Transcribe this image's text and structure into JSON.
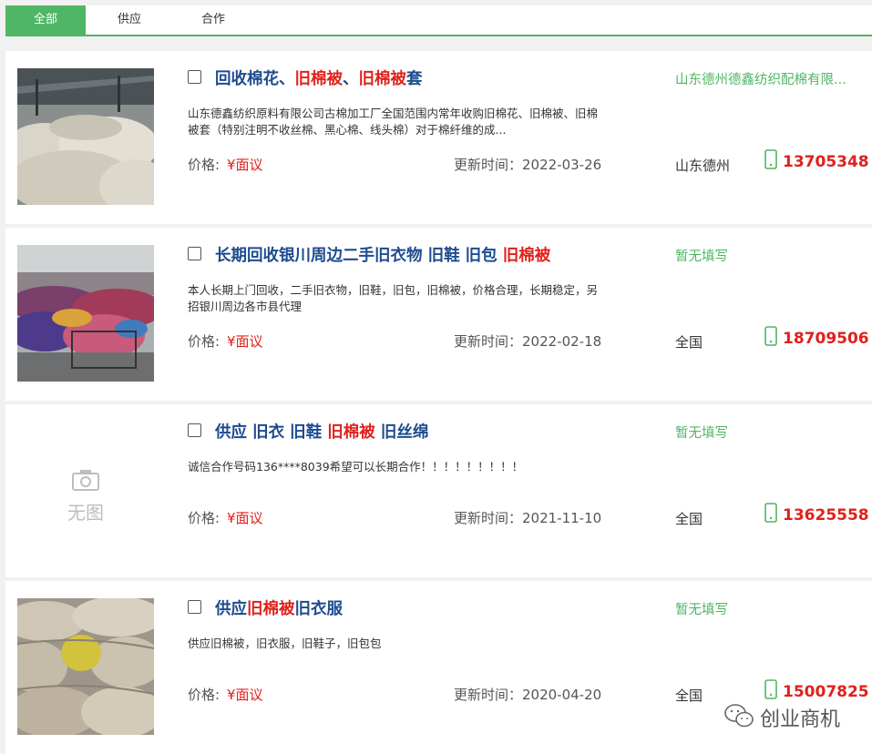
{
  "tabs": [
    {
      "label": "全部",
      "active": true
    },
    {
      "label": "供应",
      "active": false
    },
    {
      "label": "合作",
      "active": false
    }
  ],
  "listings": [
    {
      "title_parts": [
        {
          "text": "回收棉花、",
          "hl": false
        },
        {
          "text": "旧棉被",
          "hl": true
        },
        {
          "text": "、",
          "hl": false
        },
        {
          "text": "旧棉被",
          "hl": true
        },
        {
          "text": "套",
          "hl": false
        }
      ],
      "desc": "山东德鑫纺织原料有限公司古棉加工厂全国范围内常年收购旧棉花、旧棉被、旧棉被套（特别注明不收丝棉、黑心棉、线头棉）对于棉纤维的成...",
      "price_label": "价格:",
      "price": "¥面议",
      "update": "更新时间：2022-03-26",
      "company": "山东德州德鑫纺织配棉有限...",
      "location": "山东德州",
      "phone": "13705348",
      "image": "photo-warehouse-cotton"
    },
    {
      "title_parts": [
        {
          "text": "长期回收银川周边二手旧衣物 旧鞋 旧包 ",
          "hl": false
        },
        {
          "text": "旧棉被",
          "hl": true
        }
      ],
      "desc": "本人长期上门回收，二手旧衣物，旧鞋，旧包，旧棉被，价格合理，长期稳定，另招银川周边各市县代理",
      "price_label": "价格:",
      "price": "¥面议",
      "update": "更新时间：2022-02-18",
      "company": "暂无填写",
      "location": "全国",
      "phone": "18709506",
      "image": "photo-clothes-pile"
    },
    {
      "title_parts": [
        {
          "text": "供应 旧衣 旧鞋 ",
          "hl": false
        },
        {
          "text": "旧棉被",
          "hl": true
        },
        {
          "text": " 旧丝绵",
          "hl": false
        }
      ],
      "desc": "诚信合作号码136****8039希望可以长期合作！！！！！！！！！",
      "price_label": "价格:",
      "price": "¥面议",
      "update": "更新时间：2021-11-10",
      "company": "暂无填写",
      "location": "全国",
      "phone": "13625558",
      "image": "none",
      "noimg_label": "无图"
    },
    {
      "title_parts": [
        {
          "text": "供应",
          "hl": false
        },
        {
          "text": "旧棉被",
          "hl": true
        },
        {
          "text": "旧衣服",
          "hl": false
        }
      ],
      "desc": "供应旧棉被，旧衣服，旧鞋子，旧包包",
      "price_label": "价格:",
      "price": "¥面议",
      "update": "更新时间：2020-04-20",
      "company": "暂无填写",
      "location": "全国",
      "phone": "15007825",
      "image": "photo-sacks"
    }
  ],
  "watermark": {
    "text": "创业商机",
    "icon": "wechat-icon"
  },
  "colors": {
    "accent": "#4fb665",
    "title": "#1d4b8f",
    "highlight": "#e0201b"
  }
}
